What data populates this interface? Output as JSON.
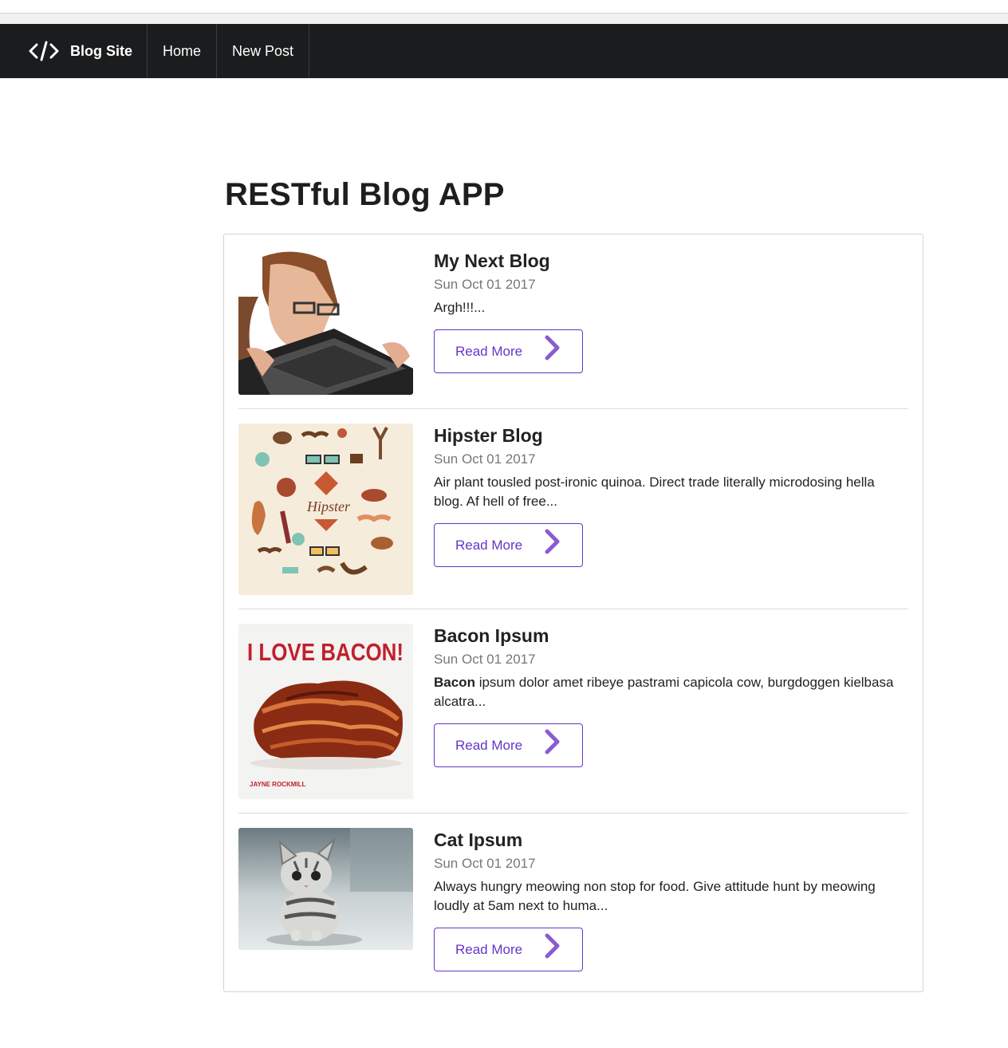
{
  "navbar": {
    "brand": "Blog Site",
    "brand_icon": "code-icon",
    "items": [
      {
        "label": "Home"
      },
      {
        "label": "New Post"
      }
    ]
  },
  "page_title": "RESTful Blog APP",
  "posts": [
    {
      "title": "My Next Blog",
      "date": "Sun Oct 01 2017",
      "excerpt": "Argh!!!...",
      "excerpt_bold": "",
      "read_more": "Read More",
      "image": "woman-biting-laptop-photo"
    },
    {
      "title": "Hipster Blog",
      "date": "Sun Oct 01 2017",
      "excerpt": "Air plant tousled post-ironic quinoa. Direct trade literally microdosing hella blog. Af hell of free...",
      "excerpt_bold": "",
      "read_more": "Read More",
      "image": "hipster-icons-illustration",
      "image_text": "Hipster"
    },
    {
      "title": "Bacon Ipsum",
      "date": "Sun Oct 01 2017",
      "excerpt_bold": "Bacon",
      "excerpt": " ipsum dolor amet ribeye pastrami capicola cow, burgdoggen kielbasa alcatra...",
      "read_more": "Read More",
      "image": "i-love-bacon-book-cover",
      "image_text": "I LOVE BACON!",
      "image_author": "JAYNE ROCKMILL"
    },
    {
      "title": "Cat Ipsum",
      "date": "Sun Oct 01 2017",
      "excerpt": "Always hungry meowing non stop for food. Give attitude hunt by meowing loudly at 5am next to huma...",
      "excerpt_bold": "",
      "read_more": "Read More",
      "image": "kitten-photo"
    }
  ],
  "colors": {
    "navbar_bg": "#1b1c1d",
    "accent": "#6435c9",
    "chevron": "#8a5cd0"
  }
}
